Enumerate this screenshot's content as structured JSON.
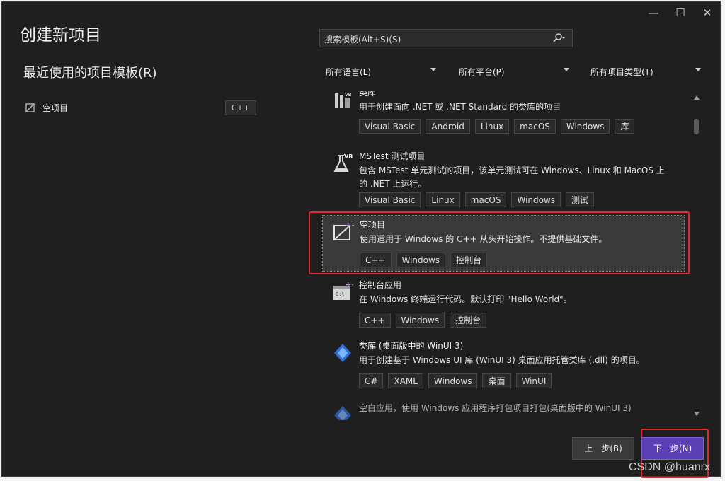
{
  "window": {
    "title": "创建新项目"
  },
  "recent": {
    "title": "最近使用的项目模板(R)",
    "items": [
      {
        "label": "空项目",
        "tag": "C++",
        "icon": "empty-project-icon"
      }
    ]
  },
  "search": {
    "placeholder": "搜索模板(Alt+S)(S)",
    "icon": "search-icon"
  },
  "filters": [
    {
      "label": "所有语言(L)"
    },
    {
      "label": "所有平台(P)"
    },
    {
      "label": "所有项目类型(T)"
    }
  ],
  "templates": [
    {
      "name": "类库",
      "desc": "用于创建面向 .NET 或 .NET Standard 的类库的项目",
      "tags": [
        "Visual Basic",
        "Android",
        "Linux",
        "macOS",
        "Windows",
        "库"
      ],
      "icon": "class-library-vb-icon"
    },
    {
      "name": "MSTest 测试项目",
      "desc": "包含 MSTest 单元测试的项目，该单元测试可在 Windows、Linux 和 MacOS 上的 .NET 上运行。",
      "tags": [
        "Visual Basic",
        "Linux",
        "macOS",
        "Windows",
        "测试"
      ],
      "icon": "mstest-vb-icon"
    },
    {
      "name": "空项目",
      "desc": "使用适用于 Windows 的 C++ 从头开始操作。不提供基础文件。",
      "tags": [
        "C++",
        "Windows",
        "控制台"
      ],
      "icon": "empty-project-icon"
    },
    {
      "name": "控制台应用",
      "desc": "在 Windows 终端运行代码。默认打印 \"Hello World\"。",
      "tags": [
        "C++",
        "Windows",
        "控制台"
      ],
      "icon": "console-app-icon"
    },
    {
      "name": "类库 (桌面版中的 WinUI 3)",
      "desc": "用于创建基于 Windows UI 库 (WinUI 3) 桌面应用托管类库 (.dll) 的项目。",
      "tags": [
        "C#",
        "XAML",
        "Windows",
        "桌面",
        "WinUI"
      ],
      "icon": "winui-icon"
    },
    {
      "name": "",
      "desc": "空白应用，使用 Windows 应用程序打包项目打包(桌面版中的 WinUI 3)",
      "tags": [],
      "icon": "winui-icon"
    }
  ],
  "buttons": {
    "prev": "上一步(B)",
    "next": "下一步(N)"
  },
  "watermark": "CSDN @huanrx",
  "colors": {
    "accent": "#5a3fb5",
    "highlight": "#e3272d",
    "background": "#1f1f1f"
  }
}
